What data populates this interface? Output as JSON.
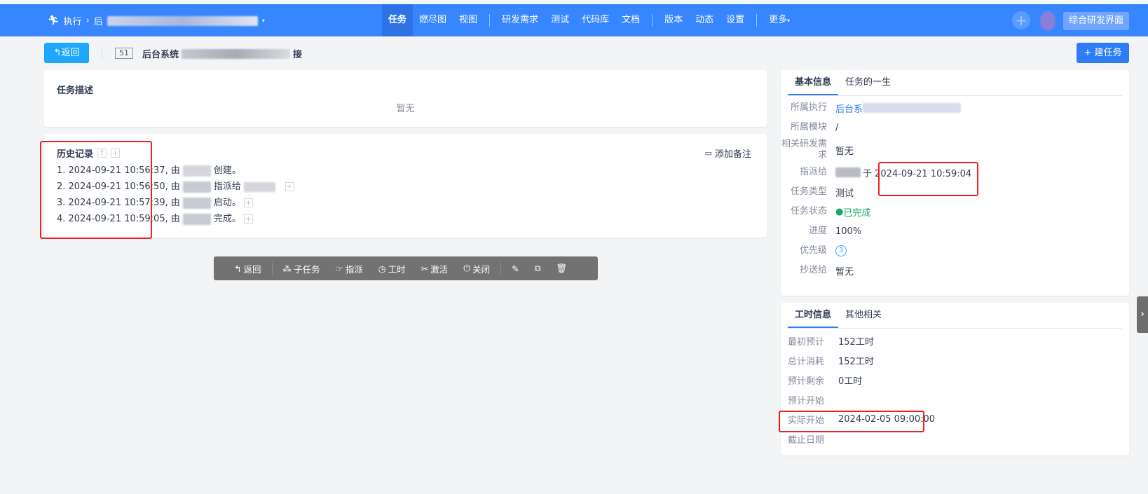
{
  "nav": {
    "breadcrumb_root": "执行",
    "breadcrumb_current_visible": "后",
    "menu": [
      "任务",
      "燃尽图",
      "视图",
      "研发需求",
      "测试",
      "代码库",
      "文档",
      "版本",
      "动态",
      "设置",
      "更多"
    ],
    "active": "任务",
    "switch_label": "综合研发界面"
  },
  "header": {
    "back_label": "返回",
    "task_id": "51",
    "title_visible": "后台系统",
    "title_tail": "接",
    "new_task_label": "建任务"
  },
  "description": {
    "title": "任务描述",
    "empty": "暂无"
  },
  "history": {
    "title": "历史记录",
    "add_note": "添加备注",
    "entries": [
      {
        "prefix": "1. 2024-09-21 10:56:37, 由",
        "action": "创建。"
      },
      {
        "prefix": "2. 2024-09-21 10:56:50, 由",
        "action": "指派给"
      },
      {
        "prefix": "3. 2024-09-21 10:57:39, 由",
        "action": "启动。"
      },
      {
        "prefix": "4. 2024-09-21 10:59:05, 由",
        "action": "完成。"
      }
    ]
  },
  "actions": {
    "back": "返回",
    "subtask": "子任务",
    "assign": "指派",
    "effort": "工时",
    "activate": "激活",
    "close": "关闭"
  },
  "basic": {
    "tabs": [
      "基本信息",
      "任务的一生"
    ],
    "rows": {
      "execution": {
        "label": "所属执行",
        "value": "后台系"
      },
      "module": {
        "label": "所属模块",
        "value": "/"
      },
      "story": {
        "label": "相关研发需求",
        "value": "暂无"
      },
      "assigned": {
        "label": "指派给",
        "value": "于 2024-09-21 10:59:04"
      },
      "type": {
        "label": "任务类型",
        "value": "测试"
      },
      "status": {
        "label": "任务状态",
        "value": "已完成",
        "color": "#16a96b"
      },
      "progress": {
        "label": "进度",
        "value": "100%"
      },
      "priority": {
        "label": "优先级",
        "value": "3"
      },
      "cc": {
        "label": "抄送给",
        "value": "暂无"
      }
    }
  },
  "effort": {
    "tabs": [
      "工时信息",
      "其他相关"
    ],
    "rows": [
      {
        "label": "最初预计",
        "value": "152工时"
      },
      {
        "label": "总计消耗",
        "value": "152工时"
      },
      {
        "label": "预计剩余",
        "value": "0工时"
      },
      {
        "label": "预计开始",
        "value": ""
      },
      {
        "label": "实际开始",
        "value": "2024-02-05 09:00:00"
      },
      {
        "label": "截止日期",
        "value": ""
      }
    ]
  }
}
